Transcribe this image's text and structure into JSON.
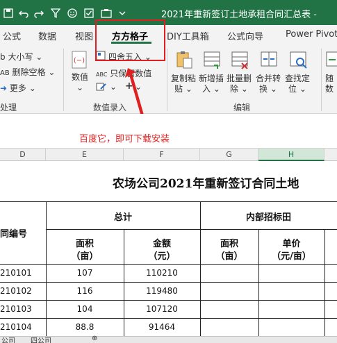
{
  "titlebar": {
    "title": "2021年重新签订土地承租合同汇总表 -",
    "qat_icons": [
      "save-icon",
      "undo-icon",
      "redo-icon",
      "filter-icon",
      "smiley-icon",
      "checkbox-icon",
      "screenshot-icon"
    ]
  },
  "ribbon_tabs": [
    {
      "label": "公式"
    },
    {
      "label": "数据"
    },
    {
      "label": "视图"
    },
    {
      "label": "方方格子"
    },
    {
      "label": "DIY工具箱"
    },
    {
      "label": "公式向导"
    },
    {
      "label": "Power Pivot"
    }
  ],
  "ribbon": {
    "left_items": [
      "大小写",
      "删除空格",
      "更多"
    ],
    "left_prefixes": [
      "b",
      "AB",
      ""
    ],
    "left_group_label": "处理",
    "numeric": {
      "big_label": "数值",
      "round_label": "四舍五入",
      "only_keep_label": "只保留数值",
      "abc_prefix": "ABC",
      "plus_label": "+",
      "group_label": "数值录入"
    },
    "edit": {
      "buttons": [
        {
          "line1": "复制粘",
          "line2": "贴"
        },
        {
          "line1": "新增插",
          "line2": "入"
        },
        {
          "line1": "批量删",
          "line2": "除"
        },
        {
          "line1": "合并转",
          "line2": "换"
        },
        {
          "line1": "查找定",
          "line2": "位"
        }
      ],
      "group_label": "编辑"
    },
    "right_button": {
      "line1": "随",
      "line2": "数"
    },
    "dropdown_arrow": "⌄"
  },
  "hint": {
    "text": "百度它，即可下载安装"
  },
  "columns": [
    "D",
    "E",
    "F",
    "G",
    "H"
  ],
  "sheet": {
    "title": "农场公司2021年重新签订合同土地",
    "group_total": "总计",
    "group_internal": "内部招标田",
    "contract_no_label": "同编号",
    "area_label": "面积",
    "area_unit": "（亩）",
    "amount_label": "金额",
    "amount_unit": "（元）",
    "unit_price_label": "单价",
    "unit_price_unit": "（元/亩）",
    "rows": [
      {
        "id": "210101",
        "area": "107",
        "amount": "110210"
      },
      {
        "id": "210102",
        "area": "116",
        "amount": "119480"
      },
      {
        "id": "210103",
        "area": "104",
        "amount": "107120"
      },
      {
        "id": "210104",
        "area": "88.8",
        "amount": "91464"
      }
    ]
  },
  "sheet_tabs": [
    "公司",
    "四公司"
  ]
}
